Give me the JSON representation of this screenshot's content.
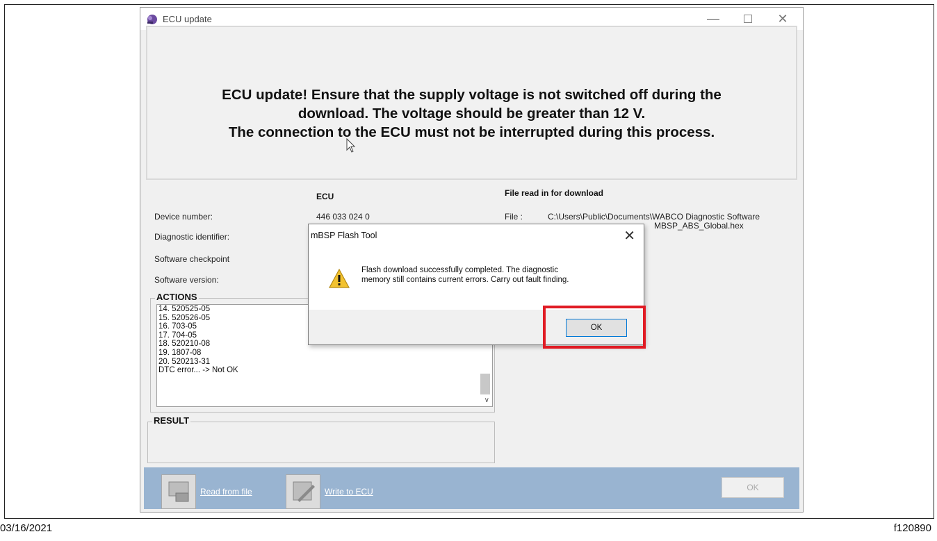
{
  "window": {
    "title": "ECU update"
  },
  "warning": {
    "line1": "ECU update! Ensure that the supply voltage is not switched off during the",
    "line2": "download. The voltage should be greater than 12 V.",
    "line3": "The connection to the ECU must not be interrupted during this process."
  },
  "info": {
    "ecu_header": "ECU",
    "file_header": "File read in for download",
    "device_number_label": "Device number:",
    "device_number_value": "446 033 024 0",
    "diagnostic_identifier_label": "Diagnostic identifier:",
    "software_checkpoint_label": "Software checkpoint",
    "software_version_label": "Software version:",
    "file_label": "File :",
    "file_path_line1": "C:\\Users\\Public\\Documents\\WABCO Diagnostic Software",
    "file_path_line2": "MBSP_ABS_Global.hex"
  },
  "actions": {
    "title": "ACTIONS",
    "items": [
      "14. 520525-05",
      "15. 520526-05",
      "16. 703-05",
      "17. 704-05",
      "18. 520210-08",
      "19. 1807-08",
      "20. 520213-31",
      "DTC error... -> Not OK"
    ]
  },
  "result": {
    "title": "RESULT"
  },
  "toolbar": {
    "read_from_file": "Read from file",
    "write_to_ecu": "Write to ECU",
    "ok": "OK"
  },
  "dialog": {
    "title": "mBSP Flash Tool",
    "message_line1": "Flash download successfully completed. The diagnostic",
    "message_line2": "memory still contains current errors. Carry out fault finding.",
    "ok": "OK"
  },
  "footer": {
    "date": "03/16/2021",
    "figure_id": "f120890"
  },
  "colors": {
    "highlight": "#e01b24",
    "bottom_bar": "#99b4d1",
    "warning_icon": "#f2c230"
  }
}
